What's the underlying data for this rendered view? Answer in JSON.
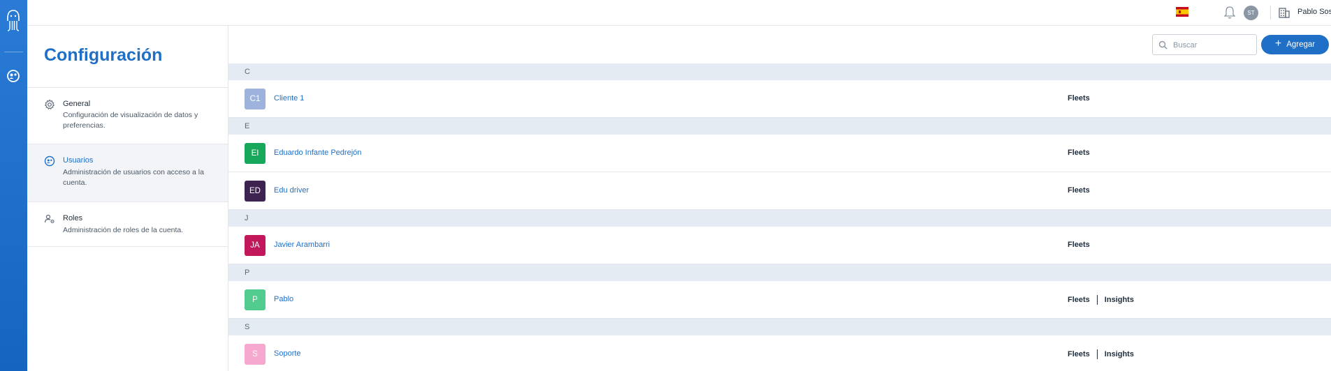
{
  "user": {
    "initials": "ST",
    "name": "Pablo Sosa"
  },
  "settings": {
    "title": "Configuración",
    "items": [
      {
        "title": "General",
        "desc": "Configuración de visualización de datos y preferencias."
      },
      {
        "title": "Usuarios",
        "desc": "Administración de usuarios con acceso a la cuenta."
      },
      {
        "title": "Roles",
        "desc": "Administración de roles de la cuenta."
      }
    ]
  },
  "toolbar": {
    "search_placeholder": "Buscar",
    "add_label": "Agregar"
  },
  "groups": [
    {
      "letter": "C",
      "users": [
        {
          "initials": "C1",
          "name": "Cliente 1",
          "color": "#9db3de",
          "apps": [
            "Fleets"
          ]
        }
      ]
    },
    {
      "letter": "E",
      "users": [
        {
          "initials": "EI",
          "name": "Eduardo Infante Pedrejón",
          "color": "#17a85c",
          "apps": [
            "Fleets"
          ]
        },
        {
          "initials": "ED",
          "name": "Edu driver",
          "color": "#3e2350",
          "apps": [
            "Fleets"
          ]
        }
      ]
    },
    {
      "letter": "J",
      "users": [
        {
          "initials": "JA",
          "name": "Javier Arambarri",
          "color": "#c2185b",
          "apps": [
            "Fleets"
          ]
        }
      ]
    },
    {
      "letter": "P",
      "users": [
        {
          "initials": "P",
          "name": "Pablo",
          "color": "#52cc8e",
          "apps": [
            "Fleets",
            "Insights"
          ]
        }
      ]
    },
    {
      "letter": "S",
      "users": [
        {
          "initials": "S",
          "name": "Soporte",
          "color": "#f7a8cf",
          "apps": [
            "Fleets",
            "Insights"
          ]
        }
      ]
    }
  ],
  "colors": {
    "accent": "#1f6fc6",
    "rail": "#1565c0",
    "group_bg": "#e4ebf3"
  }
}
